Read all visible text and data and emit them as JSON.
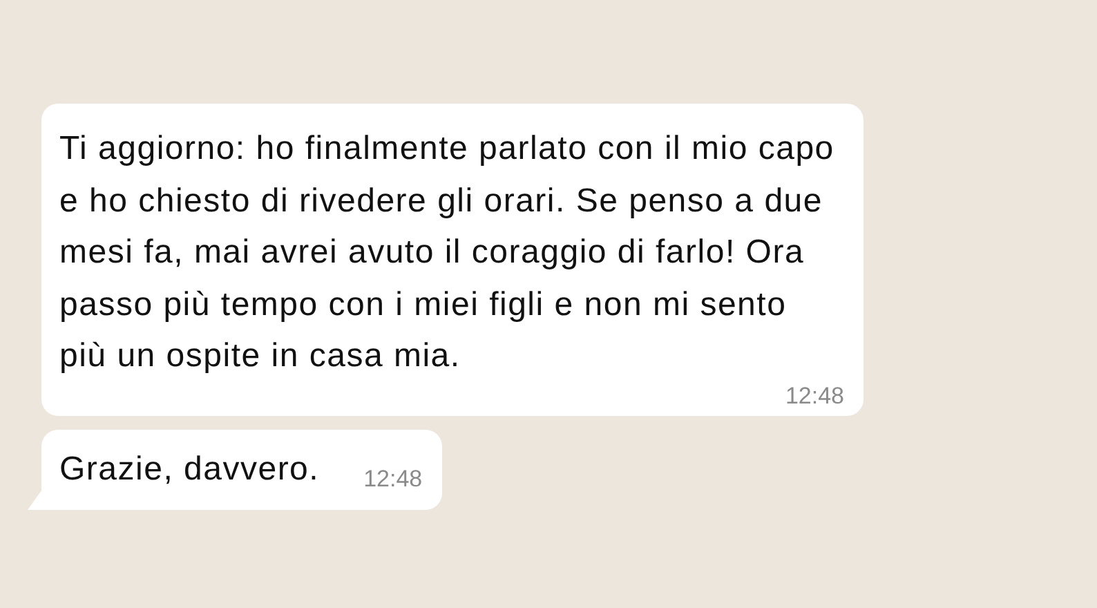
{
  "messages": [
    {
      "text": "Ti aggiorno: ho finalmente parlato con il mio capo e ho chiesto di rivedere gli orari. Se penso a due mesi fa, mai avrei avuto il coraggio di farlo! Ora passo più tempo con i miei figli e non mi sento più un ospite in casa mia.",
      "time": "12:48",
      "tail": false
    },
    {
      "text": "Grazie, davvero.",
      "time": "12:48",
      "tail": true
    }
  ]
}
